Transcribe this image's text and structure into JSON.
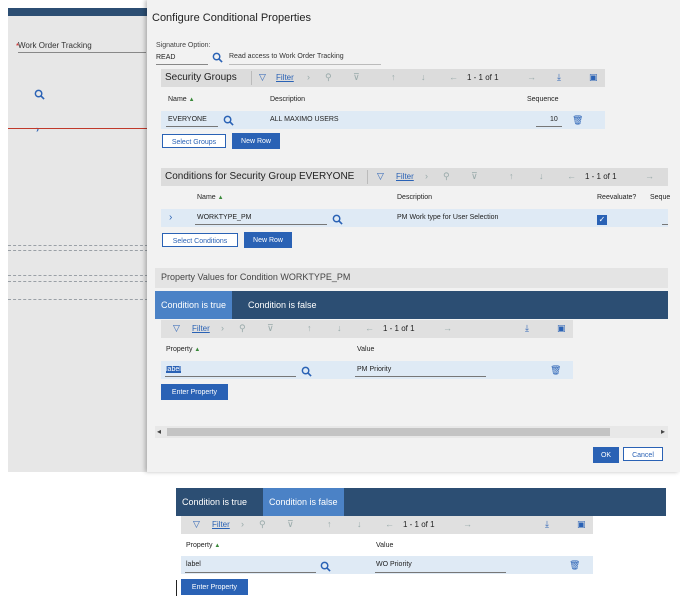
{
  "background_app": {
    "title": "Work Order Tracking",
    "required_mark": "*"
  },
  "dialog": {
    "title": "Configure Conditional Properties"
  },
  "signature": {
    "label": "Signature Option:",
    "value": "READ",
    "description": "Read access to Work Order Tracking"
  },
  "security_groups": {
    "title": "Security Groups",
    "filter_label": "Filter",
    "pagination": "1 - 1 of 1",
    "columns": [
      "Name",
      "Description",
      "Sequence"
    ],
    "rows": [
      {
        "name": "EVERYONE",
        "description": "ALL MAXIMO USERS",
        "sequence": "10"
      }
    ],
    "select_button": "Select Groups",
    "new_row_button": "New Row"
  },
  "conditions": {
    "title": "Conditions for Security Group EVERYONE",
    "filter_label": "Filter",
    "pagination": "1 - 1 of 1",
    "columns": [
      "Name",
      "Description",
      "Reevaluate?",
      "Seque"
    ],
    "rows": [
      {
        "name": "WORKTYPE_PM",
        "description": "PM Work type for User Selection",
        "reevaluate": true
      }
    ],
    "select_button": "Select Conditions",
    "new_row_button": "New Row"
  },
  "property_values": {
    "title": "Property Values for Condition WORKTYPE_PM",
    "tabs": [
      "Condition is true",
      "Condition is false"
    ],
    "filter_label": "Filter",
    "pagination": "1 - 1 of 1",
    "columns": [
      "Property",
      "Value"
    ],
    "rows": [
      {
        "property": "label",
        "value": "PM Priority"
      }
    ],
    "enter_property_button": "Enter Property"
  },
  "footer": {
    "ok": "OK",
    "cancel": "Cancel"
  },
  "overlay_panel": {
    "tabs": [
      "Condition is true",
      "Condition is false"
    ],
    "filter_label": "Filter",
    "pagination": "1 - 1 of 1",
    "columns": [
      "Property",
      "Value"
    ],
    "rows": [
      {
        "property": "label",
        "value": "WO Priority"
      }
    ],
    "enter_property_button": "Enter Property"
  },
  "colors": {
    "accent": "#2a62b5",
    "tab_bar": "#2c4e73",
    "active_tab": "#4b82c6",
    "row_highlight": "#dfeaf5"
  }
}
